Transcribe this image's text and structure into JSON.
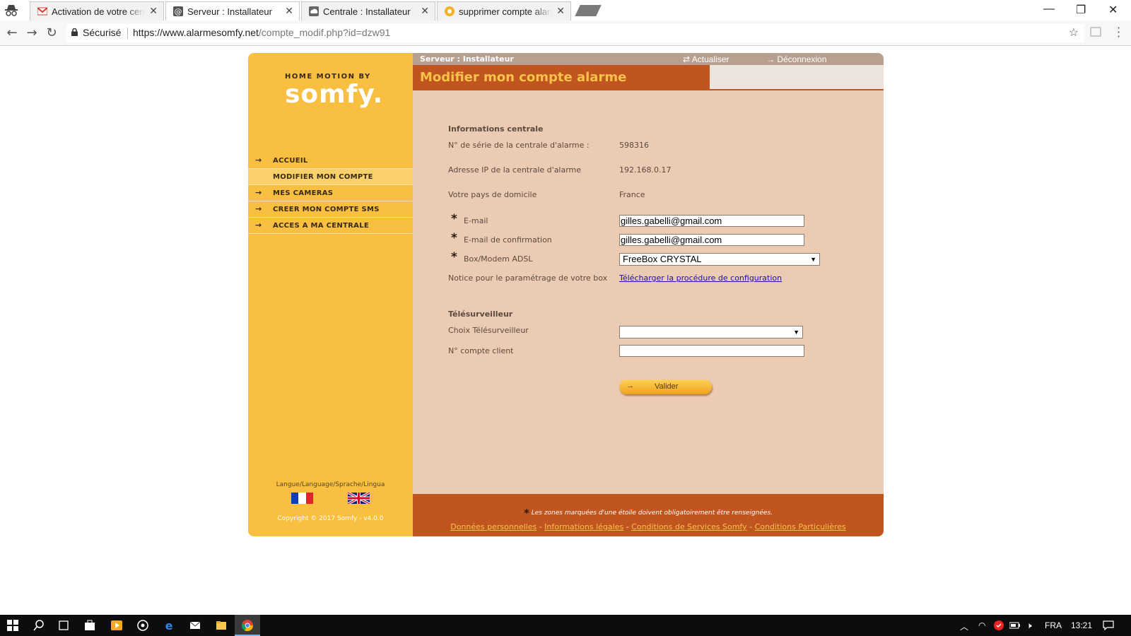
{
  "browser": {
    "tabs": [
      {
        "title": "Activation de votre centr",
        "favicon": "gmail-icon"
      },
      {
        "title": "Serveur : Installateur",
        "favicon": "at-icon"
      },
      {
        "title": "Centrale : Installateur",
        "favicon": "cloud-icon"
      },
      {
        "title": "supprimer compte alarm",
        "favicon": "somfy-icon"
      }
    ],
    "secure_label": "Sécurisé",
    "url_host": "https://www.alarmesomfy.net",
    "url_path": "/compte_modif.php?id=dzw91"
  },
  "brand": {
    "small": "HOME MOTION BY",
    "logo": "somfy."
  },
  "sidebar": {
    "items": [
      {
        "label": "ACCUEIL"
      },
      {
        "label": "MODIFIER MON COMPTE"
      },
      {
        "label": "MES CAMERAS"
      },
      {
        "label": "CREER MON COMPTE SMS"
      },
      {
        "label": "ACCES A MA CENTRALE"
      }
    ],
    "lang_label": "Langue/Language/Sprache/Lingua",
    "copyright": "Copyright © 2017 Somfy - v4.0.0"
  },
  "topbar": {
    "server": "Serveur : Installateur",
    "refresh": "Actualiser",
    "logout": "Déconnexion"
  },
  "page_title": "Modifier mon compte alarme",
  "info": {
    "section": "Informations centrale",
    "serial_label": "N° de série de la centrale d'alarme :",
    "serial_value": "598316",
    "ip_label": "Adresse IP de la centrale d'alarme",
    "ip_value": "192.168.0.17",
    "country_label": "Votre pays de domicile",
    "country_value": "France"
  },
  "form": {
    "email_label": "E-mail",
    "email_value": "gilles.gabelli@gmail.com",
    "email_confirm_label": "E-mail de confirmation",
    "email_confirm_value": "gilles.gabelli@gmail.com",
    "box_label": "Box/Modem ADSL",
    "box_value": "FreeBox CRYSTAL",
    "notice_label": "Notice pour le paramétrage de votre box",
    "notice_link": "Télécharger la procédure de configuration"
  },
  "telesurveillance": {
    "section": "Télésurveilleur",
    "choice_label": "Choix Télésurveilleur",
    "choice_value": "",
    "account_label": "N° compte client",
    "account_value": ""
  },
  "submit_label": "Valider",
  "footer": {
    "note": "Les zones marquées d'une étoile doivent obligatoirement être renseignées.",
    "links": [
      "Données personnelles",
      "Informations légales",
      "Conditions de Services Somfy",
      "Conditions Particulières"
    ]
  },
  "taskbar": {
    "lang": "FRA",
    "time": "13:21"
  },
  "colors": {
    "sidebar": "#f8bf40",
    "main_bg": "#eccbb4",
    "accent": "#c1551f",
    "title_text": "#f9c24a"
  }
}
